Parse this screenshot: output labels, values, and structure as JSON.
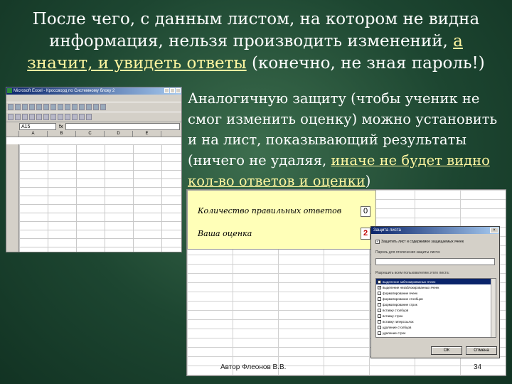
{
  "slide": {
    "title_line1": "После чего, с данным листом, на котором не видна",
    "title_line2_plain": "информация, нельзя производить изменений, ",
    "title_line2_u": "а",
    "title_line3_u": "значит, и увидеть ответы",
    "title_line3_plain": " (конечно, не зная пароль!)",
    "body_plain1": "Аналогичную защиту (чтобы ученик не смог изменить оценку) можно установить и на лист, показывающий результаты (ничего не удаляя, ",
    "body_u": "иначе не будет видно кол-во ответов и оценки",
    "body_plain2": ")",
    "footer_author": "Автор Флеонов В.В.",
    "footer_page": "34"
  },
  "excel_window": {
    "title": "Microsoft Excel - Кроссворд по Системному блоку 2",
    "name_box": "A15",
    "fx": "fx",
    "columns": [
      "A",
      "B",
      "C",
      "D",
      "E"
    ]
  },
  "results_sheet": {
    "correct_label": "Количество правильных ответов",
    "correct_value": "0",
    "grade_label": "Ваша оценка",
    "grade_value": "2"
  },
  "protect_dialog": {
    "title": "Защита листа",
    "close": "×",
    "checkbox_mark": "✓",
    "checkbox_label": "Защитить лист и содержимое защищаемых ячеек",
    "password_label": "Пароль для отключения защиты листа:",
    "allow_label": "Разрешить всем пользователям этого листа:",
    "items": [
      "выделение заблокированных ячеек",
      "выделение незаблокированных ячеек",
      "форматирование ячеек",
      "форматирование столбцов",
      "форматирование строк",
      "вставку столбцов",
      "вставку строк",
      "вставку гиперссылок",
      "удаление столбцов",
      "удаление строк"
    ],
    "ok_label": "ОК",
    "cancel_label": "Отмена"
  },
  "colors": {
    "background": "#1d4631",
    "highlight_text": "#fff6a0",
    "result_panel": "#ffffb8",
    "grade_value": "#c00000"
  }
}
